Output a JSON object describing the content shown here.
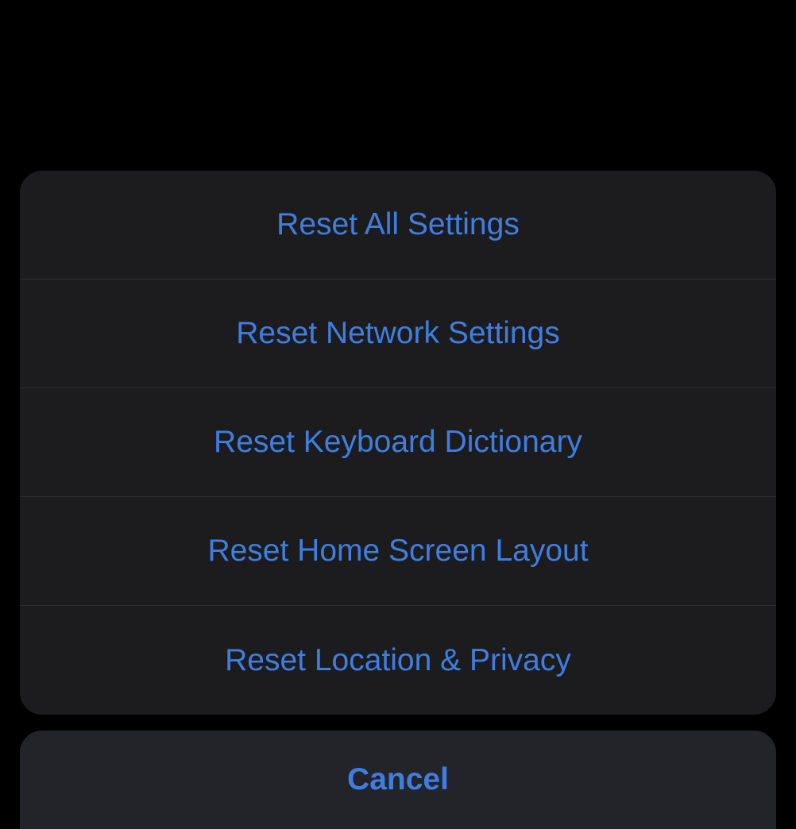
{
  "actionSheet": {
    "options": [
      {
        "label": "Reset All Settings"
      },
      {
        "label": "Reset Network Settings"
      },
      {
        "label": "Reset Keyboard Dictionary"
      },
      {
        "label": "Reset Home Screen Layout"
      },
      {
        "label": "Reset Location & Privacy"
      }
    ],
    "cancelLabel": "Cancel"
  }
}
